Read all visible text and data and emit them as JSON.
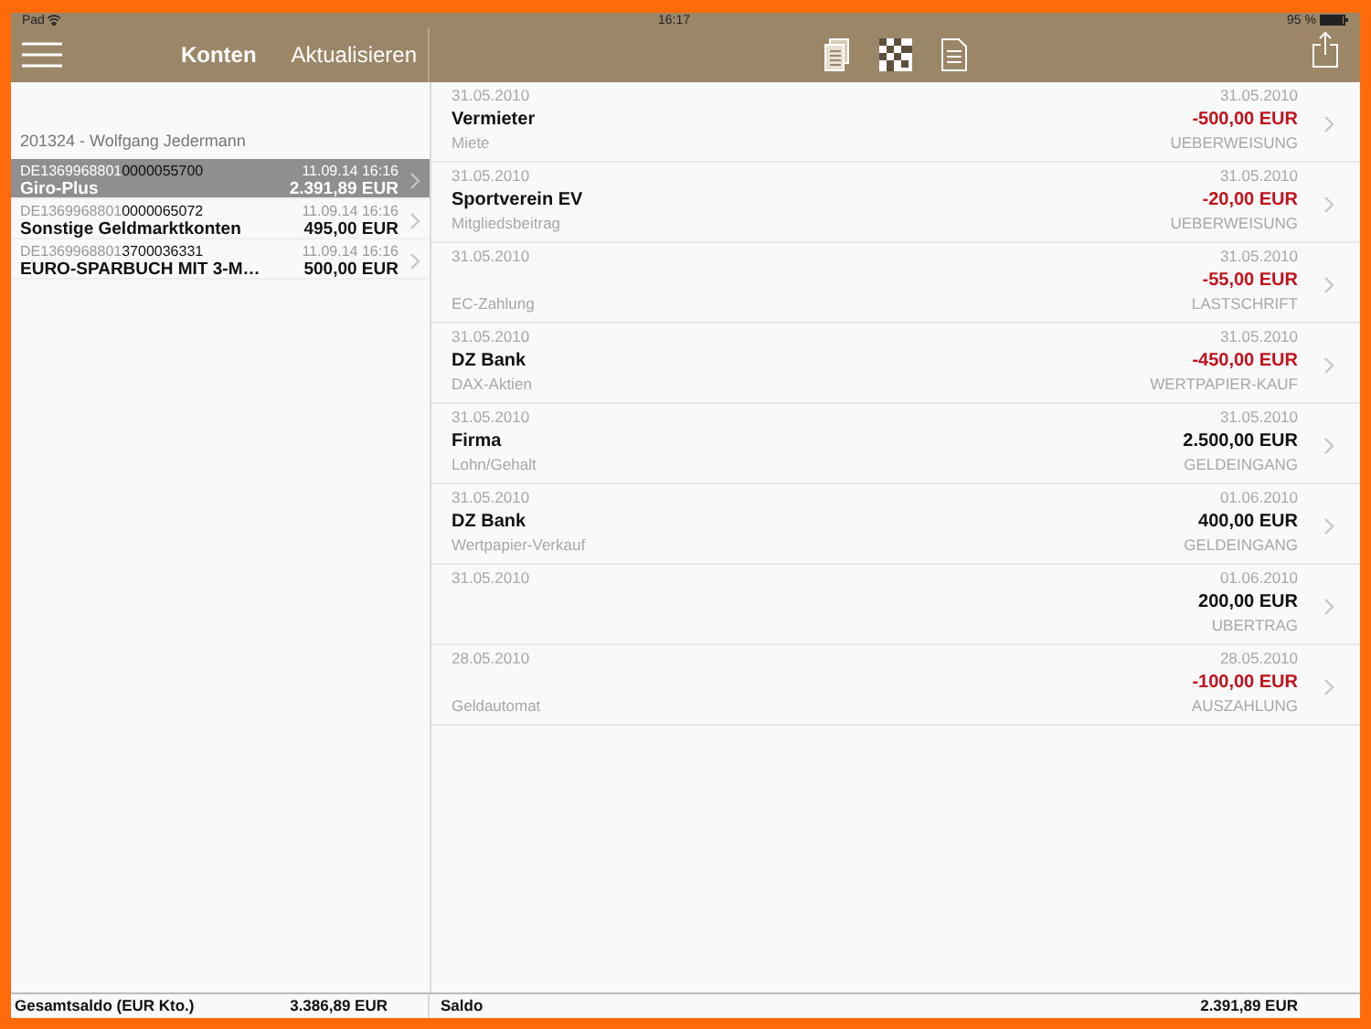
{
  "status_bar": {
    "carrier": "Pad",
    "time": "16:17",
    "battery": "95 %"
  },
  "toolbar": {
    "title": "Konten",
    "refresh": "Aktualisieren"
  },
  "accounts": {
    "owner": "201324 - Wolfgang Jedermann",
    "items": [
      {
        "iban_prefix": "DE1369968801",
        "number": "0000055700",
        "timestamp": "11.09.14 16:16",
        "name": "Giro-Plus",
        "balance": "2.391,89 EUR",
        "selected": true
      },
      {
        "iban_prefix": "DE1369968801",
        "number": "0000065072",
        "timestamp": "11.09.14 16:16",
        "name": "Sonstige Geldmarktkonten",
        "balance": "495,00 EUR",
        "selected": false
      },
      {
        "iban_prefix": "DE1369968801",
        "number": "3700036331",
        "timestamp": "11.09.14 16:16",
        "name": "EURO-SPARBUCH MIT 3-M…",
        "balance": "500,00 EUR",
        "selected": false
      }
    ],
    "total_label": "Gesamtsaldo (EUR Kto.)",
    "total": "3.386,89 EUR"
  },
  "transactions": [
    {
      "booking_date": "31.05.2010",
      "payee": "Vermieter",
      "purpose": "Miete",
      "value_date": "31.05.2010",
      "amount": "-500,00 EUR",
      "negative": true,
      "type": "UEBERWEISUNG"
    },
    {
      "booking_date": "31.05.2010",
      "payee": "Sportverein EV",
      "purpose": "Mitgliedsbeitrag",
      "value_date": "31.05.2010",
      "amount": "-20,00 EUR",
      "negative": true,
      "type": "UEBERWEISUNG"
    },
    {
      "booking_date": "31.05.2010",
      "purpose": "EC-Zahlung",
      "value_date": "31.05.2010",
      "amount": "-55,00 EUR",
      "negative": true,
      "type": "LASTSCHRIFT"
    },
    {
      "booking_date": "31.05.2010",
      "payee": "DZ Bank",
      "purpose": "DAX-Aktien",
      "value_date": "31.05.2010",
      "amount": "-450,00 EUR",
      "negative": true,
      "type": "WERTPAPIER-KAUF"
    },
    {
      "booking_date": "31.05.2010",
      "payee": "Firma",
      "purpose": "Lohn/Gehalt",
      "value_date": "31.05.2010",
      "amount": "2.500,00 EUR",
      "negative": false,
      "type": "GELDEINGANG"
    },
    {
      "booking_date": "31.05.2010",
      "payee": "DZ Bank",
      "purpose": "Wertpapier-Verkauf",
      "value_date": "01.06.2010",
      "amount": "400,00 EUR",
      "negative": false,
      "type": "GELDEINGANG"
    },
    {
      "booking_date": "31.05.2010",
      "value_date": "01.06.2010",
      "amount": "200,00 EUR",
      "negative": false,
      "type": "UBERTRAG"
    },
    {
      "booking_date": "28.05.2010",
      "purpose": "Geldautomat",
      "value_date": "28.05.2010",
      "amount": "-100,00 EUR",
      "negative": true,
      "type": "AUSZAHLUNG"
    }
  ],
  "footer": {
    "label": "Saldo",
    "balance": "2.391,89 EUR"
  }
}
